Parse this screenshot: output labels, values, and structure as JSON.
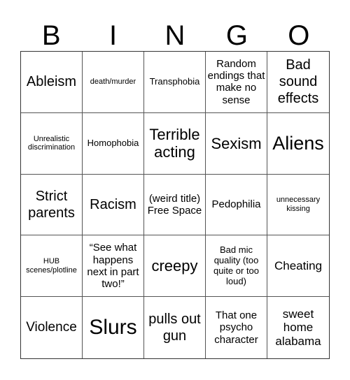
{
  "header": {
    "letters": [
      "B",
      "I",
      "N",
      "G",
      "O"
    ]
  },
  "cells": [
    "Ableism",
    "death/murder",
    "Transphobia",
    "Random endings that make no sense",
    "Bad sound effects",
    "Unrealistic discrimination",
    "Homophobia",
    "Terrible acting",
    "Sexism",
    "Aliens",
    "Strict parents",
    "Racism",
    "(weird title) Free Space",
    "Pedophilia",
    "unnecessary kissing",
    "HUB scenes/plotline",
    "“See what happens next in part two!”",
    "creepy",
    "Bad mic quality (too quite or too loud)",
    "Cheating",
    "Violence",
    "Slurs",
    "pulls out gun",
    "That one psycho character",
    "sweet home alabama"
  ]
}
